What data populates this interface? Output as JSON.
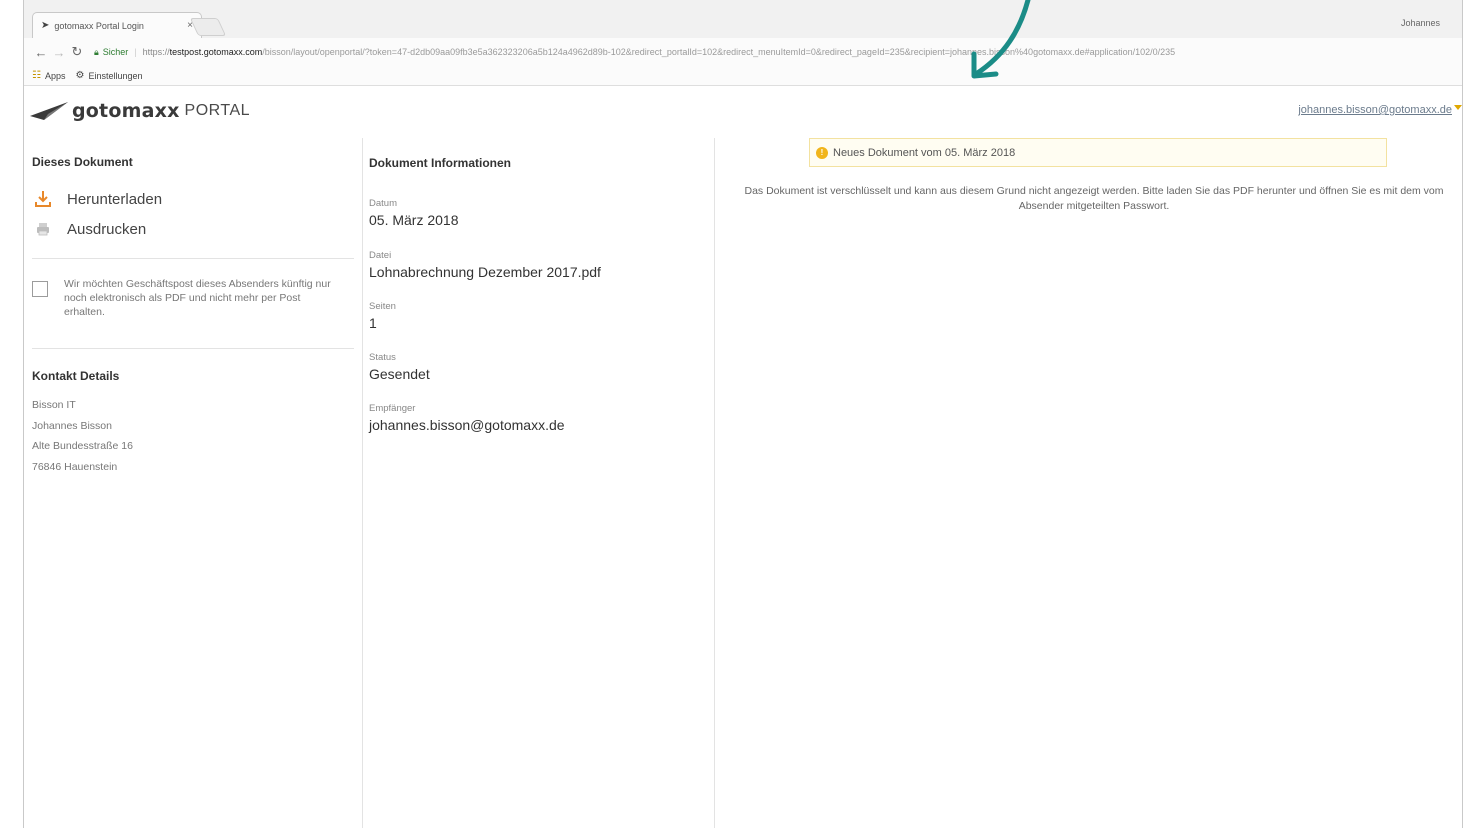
{
  "browser": {
    "tab_title": "gotomaxx Portal Login",
    "tab_close": "×",
    "window_user": "Johannes",
    "secure_label": "Sicher",
    "url_scheme": "https://",
    "url_host": "testpost.gotomaxx.com",
    "url_rest": "/bisson/layout/openportal/?token=47-d2db09aa09fb3e5a362323206a5b124a4962d89b-102&redirect_portalId=102&redirect_menuItemId=0&redirect_pageId=235&recipient=johannes.bisson%40gotomaxx.de#application/102/0/235",
    "bookmarks": [
      {
        "label": "Apps"
      },
      {
        "label": "Einstellungen"
      }
    ]
  },
  "header": {
    "logo_word": "gotomaxx",
    "logo_portal": "PORTAL",
    "user_email": "johannes.bisson@gotomaxx.de"
  },
  "left": {
    "title": "Dieses Dokument",
    "download_label": "Herunterladen",
    "print_label": "Ausdrucken",
    "checkbox_text": "Wir möchten Geschäftspost dieses Absenders künftig nur noch elektronisch als PDF und nicht mehr per Post erhalten.",
    "checkbox_checked": false,
    "contact_title": "Kontakt Details",
    "contact_lines": [
      "Bisson IT",
      "Johannes Bisson",
      "Alte Bundesstraße 16",
      "76846 Hauenstein"
    ]
  },
  "middle": {
    "title": "Dokument Informationen",
    "fields": [
      {
        "label": "Datum",
        "value": "05. März 2018"
      },
      {
        "label": "Datei",
        "value": "Lohnabrechnung Dezember 2017.pdf"
      },
      {
        "label": "Seiten",
        "value": "1"
      },
      {
        "label": "Status",
        "value": "Gesendet"
      },
      {
        "label": "Empfänger",
        "value": "johannes.bisson@gotomaxx.de"
      }
    ]
  },
  "right": {
    "notice_icon": "!",
    "notice_text": "Neues Dokument vom 05. März 2018",
    "encrypted_message": "Das Dokument ist verschlüsselt und kann aus diesem Grund nicht angezeigt werden. Bitte laden Sie das PDF herunter und öffnen Sie es mit dem vom Absender mitgeteilten Passwort."
  },
  "colors": {
    "accent_orange": "#e8882a",
    "notice_border": "#f3e2a0",
    "notice_icon": "#f1b51c",
    "arrow": "#1b8c87",
    "secure_green": "#2e7d32"
  }
}
